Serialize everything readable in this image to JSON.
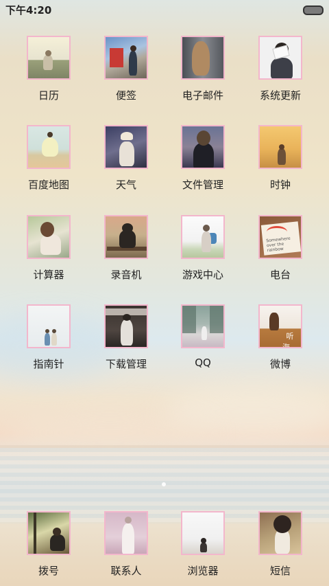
{
  "status_bar": {
    "time": "下午4:20",
    "battery_icon": "battery-icon"
  },
  "apps": [
    {
      "label": "日历"
    },
    {
      "label": "便签"
    },
    {
      "label": "电子邮件"
    },
    {
      "label": "系统更新"
    },
    {
      "label": "百度地图"
    },
    {
      "label": "天气"
    },
    {
      "label": "文件管理"
    },
    {
      "label": "时钟"
    },
    {
      "label": "计算器"
    },
    {
      "label": "录音机"
    },
    {
      "label": "游戏中心"
    },
    {
      "label": "电台"
    },
    {
      "label": "指南针"
    },
    {
      "label": "下载管理"
    },
    {
      "label": "QQ"
    },
    {
      "label": "微博"
    }
  ],
  "icon_texts": {
    "radio_note": "Somewhere over the rainbow",
    "weibo_caption": "听海。"
  },
  "dock": [
    {
      "label": "拨号"
    },
    {
      "label": "联系人"
    },
    {
      "label": "浏览器"
    },
    {
      "label": "短信"
    }
  ],
  "accent_colors": {
    "icon_border": "#f3b6cc"
  }
}
